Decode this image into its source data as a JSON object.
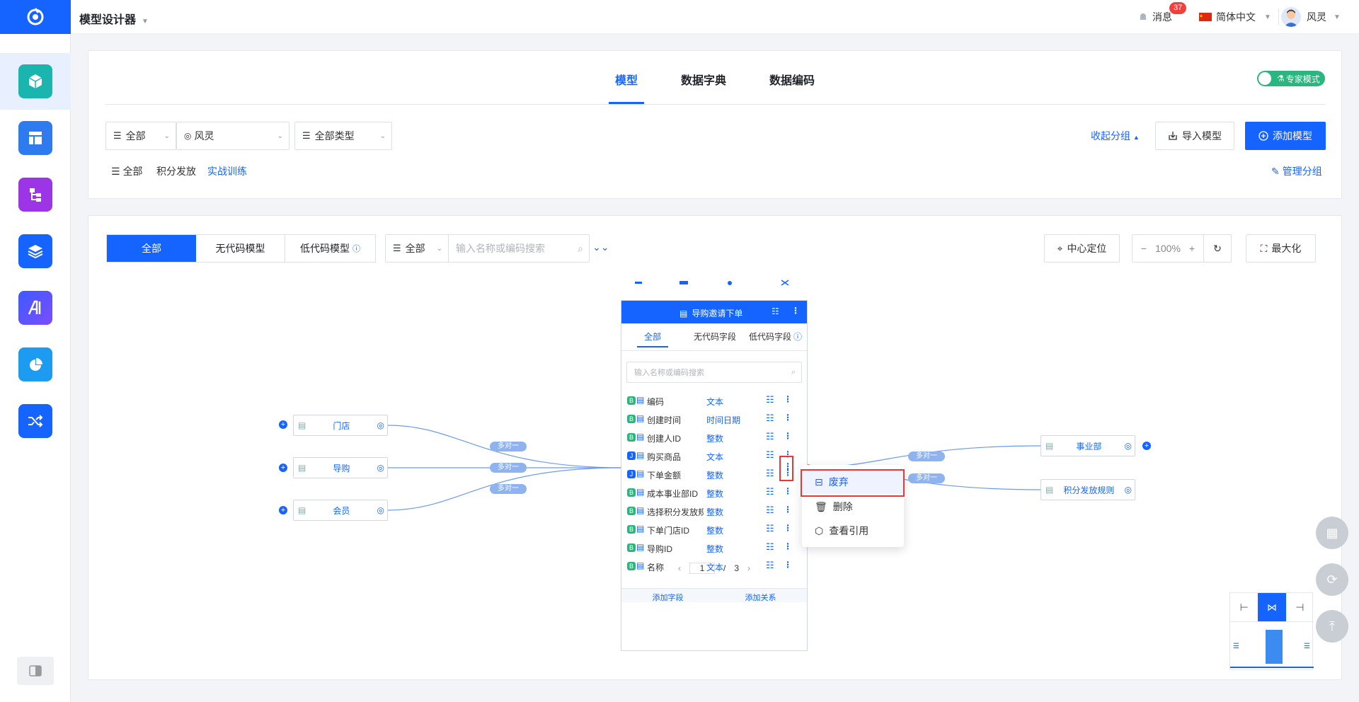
{
  "header": {
    "app_title": "模型设计器",
    "messages_label": "消息",
    "messages_count": "37",
    "language_label": "简体中文",
    "user_name": "风灵"
  },
  "top_tabs": [
    "模型",
    "数据字典",
    "数据编码"
  ],
  "expert_mode_label": "专家模式",
  "filters": {
    "scope_select": "全部",
    "owner_select": "风灵",
    "type_select": "全部类型"
  },
  "toolbar": {
    "collapse_groups": "收起分组",
    "import_model": "导入模型",
    "add_model": "添加模型",
    "manage_groups": "管理分组"
  },
  "group_tabs": [
    "全部",
    "积分发放",
    "实战训练"
  ],
  "canvas_toolbar": {
    "segments": [
      "全部",
      "无代码模型",
      "低代码模型"
    ],
    "search_scope": "全部",
    "search_placeholder": "输入名称或编码搜索",
    "center_locate": "中心定位",
    "zoom": "100%",
    "maximize": "最大化"
  },
  "left_nodes": [
    "门店",
    "导购",
    "会员"
  ],
  "right_nodes": [
    "事业部",
    "积分发放规则"
  ],
  "relation_label": "多对一",
  "model_panel": {
    "title": "导购邀请下单",
    "tabs": [
      "全部",
      "无代码字段",
      "低代码字段"
    ],
    "search_placeholder": "输入名称或编码搜索",
    "fields": [
      {
        "name": "编码",
        "type": "文本"
      },
      {
        "name": "创建时间",
        "type": "时间日期"
      },
      {
        "name": "创建人ID",
        "type": "整数"
      },
      {
        "name": "购买商品",
        "type": "文本"
      },
      {
        "name": "下单金额",
        "type": "整数"
      },
      {
        "name": "成本事业部ID",
        "type": "整数"
      },
      {
        "name": "选择积分发放规",
        "type": "整数"
      },
      {
        "name": "下单门店ID",
        "type": "整数"
      },
      {
        "name": "导购ID",
        "type": "整数"
      },
      {
        "name": "名称",
        "type": "文本"
      }
    ],
    "page_current": "1",
    "page_sep": "/",
    "page_total": "3",
    "add_field": "添加字段",
    "add_relation": "添加关系"
  },
  "context_menu": {
    "items": [
      "废弃",
      "删除",
      "查看引用"
    ]
  },
  "colors": {
    "primary": "#1664ff",
    "highlight_border": "#e53935",
    "expert_toggle": "#2bb57f",
    "badge": "#f53f3f"
  }
}
